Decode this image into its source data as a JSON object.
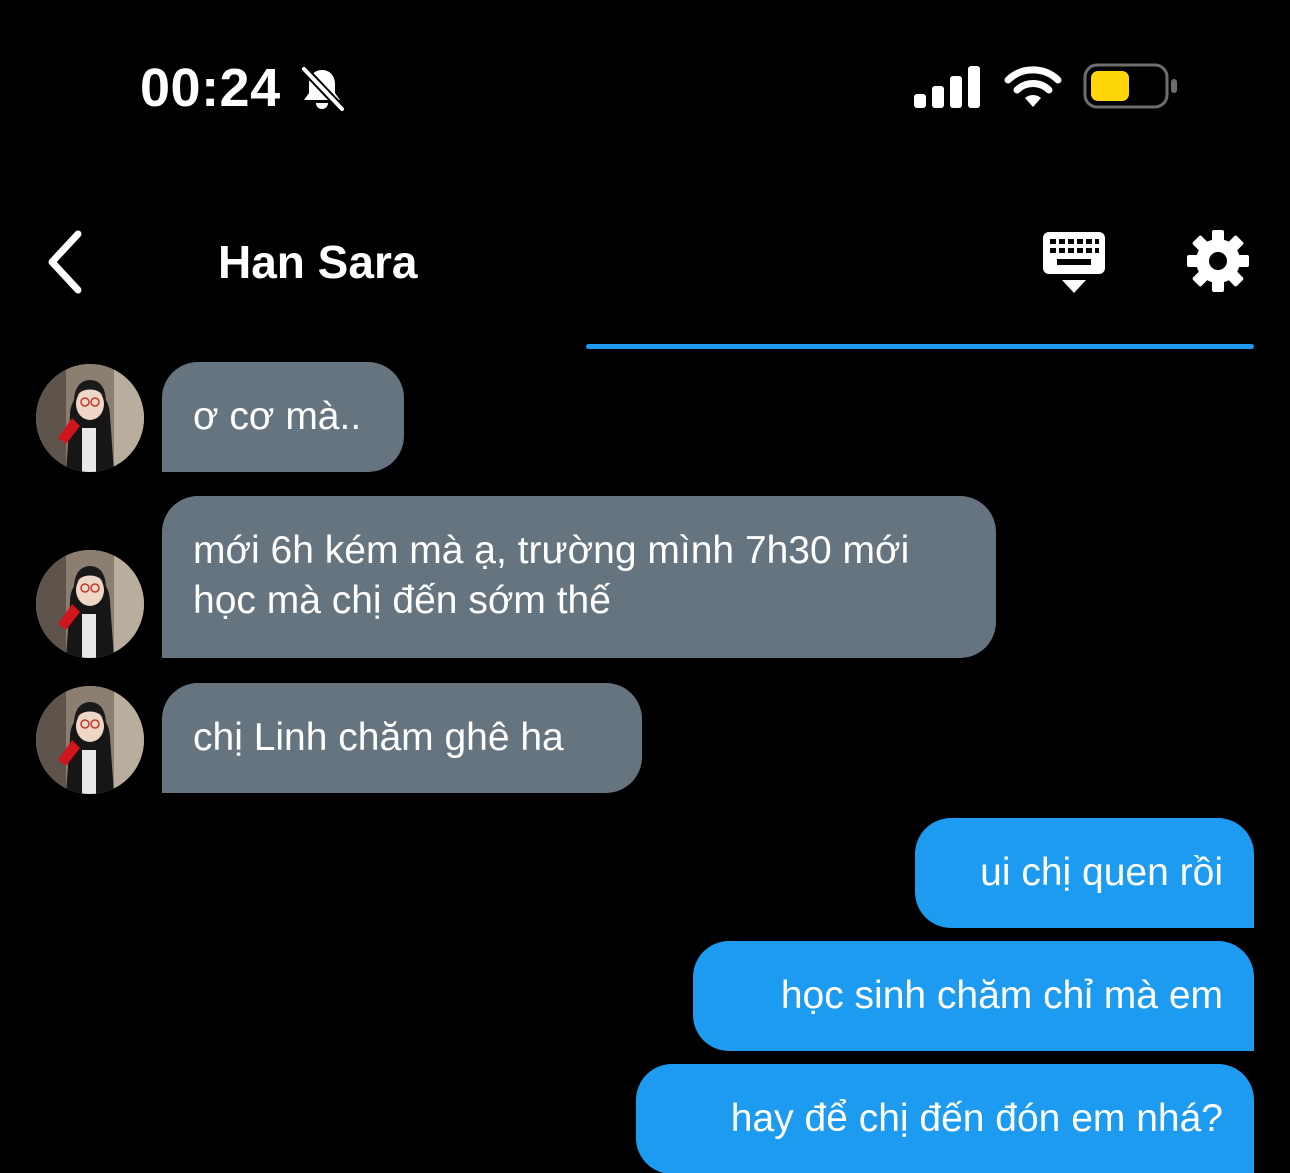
{
  "status_bar": {
    "time": "00:24",
    "icons": [
      "bell-slash-icon",
      "signal-icon",
      "wifi-icon",
      "battery-icon"
    ],
    "battery_color": "#ffd60a"
  },
  "header": {
    "back_icon": "chevron-left-icon",
    "title": "Han Sara",
    "actions": [
      "keyboard-icon",
      "gear-icon"
    ]
  },
  "colors": {
    "background": "#000000",
    "incoming_bubble": "#66747f",
    "outgoing_bubble": "#1d9bf0",
    "accent": "#1d9bf0"
  },
  "messages": [
    {
      "direction": "incoming",
      "text": "ơ cơ mà.."
    },
    {
      "direction": "incoming",
      "text": "mới 6h kém mà ạ, trường mình 7h30 mới học mà chị đến sớm thế"
    },
    {
      "direction": "incoming",
      "text": "chị Linh chăm ghê ha"
    },
    {
      "direction": "outgoing",
      "text": "ui chị quen rồi"
    },
    {
      "direction": "outgoing",
      "text": "học sinh chăm chỉ mà em"
    },
    {
      "direction": "outgoing",
      "text": "hay để chị đến đón em nhá?"
    }
  ]
}
